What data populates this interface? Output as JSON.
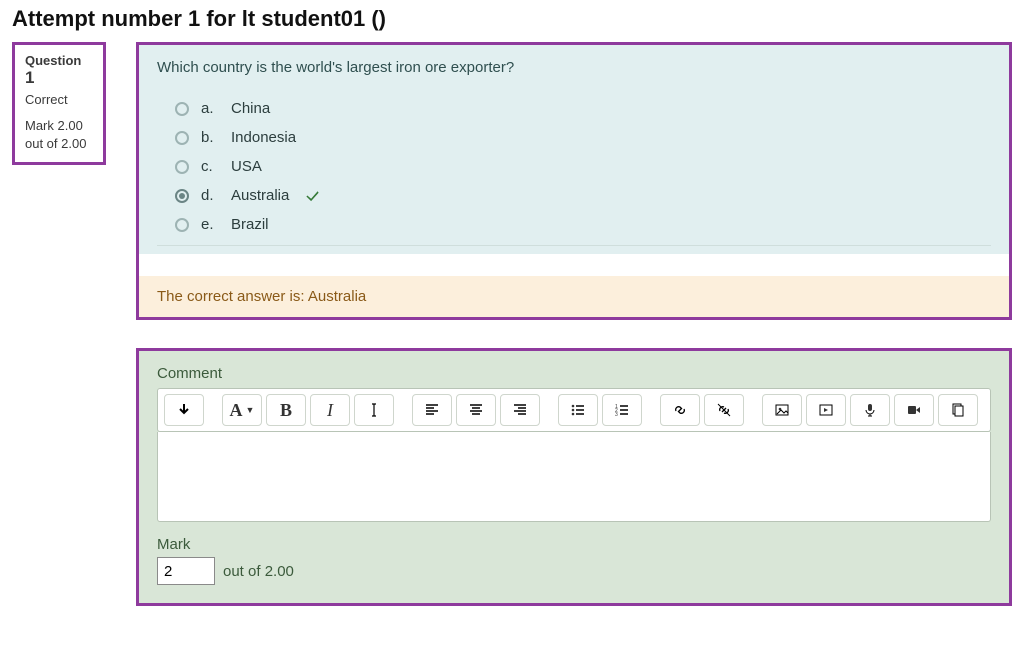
{
  "page": {
    "title": "Attempt number 1 for lt student01 ()"
  },
  "info": {
    "question_label": "Question",
    "number": "1",
    "status": "Correct",
    "mark_text": "Mark 2.00 out of 2.00"
  },
  "question": {
    "text": "Which country is the world's largest iron ore exporter?",
    "answers": [
      {
        "letter": "a.",
        "text": "China",
        "selected": false,
        "correct": false
      },
      {
        "letter": "b.",
        "text": "Indonesia",
        "selected": false,
        "correct": false
      },
      {
        "letter": "c.",
        "text": "USA",
        "selected": false,
        "correct": false
      },
      {
        "letter": "d.",
        "text": "Australia",
        "selected": true,
        "correct": true
      },
      {
        "letter": "e.",
        "text": "Brazil",
        "selected": false,
        "correct": false
      }
    ],
    "feedback": "The correct answer is: Australia"
  },
  "comment": {
    "label": "Comment",
    "value": ""
  },
  "mark": {
    "label": "Mark",
    "value": "2",
    "out_of": "out of 2.00"
  },
  "toolbar": {
    "groups": [
      [
        {
          "name": "toggle-toolbar-icon"
        }
      ],
      [
        {
          "name": "paragraph-style-icon"
        },
        {
          "name": "bold-icon"
        },
        {
          "name": "italic-icon"
        },
        {
          "name": "text-cursor-icon"
        }
      ],
      [
        {
          "name": "align-left-icon"
        },
        {
          "name": "align-center-icon"
        },
        {
          "name": "align-right-icon"
        }
      ],
      [
        {
          "name": "bullet-list-icon"
        },
        {
          "name": "numbered-list-icon"
        }
      ],
      [
        {
          "name": "link-icon"
        },
        {
          "name": "unlink-icon"
        }
      ],
      [
        {
          "name": "image-icon"
        },
        {
          "name": "media-icon"
        },
        {
          "name": "microphone-icon"
        },
        {
          "name": "video-icon"
        },
        {
          "name": "files-icon"
        }
      ]
    ]
  }
}
